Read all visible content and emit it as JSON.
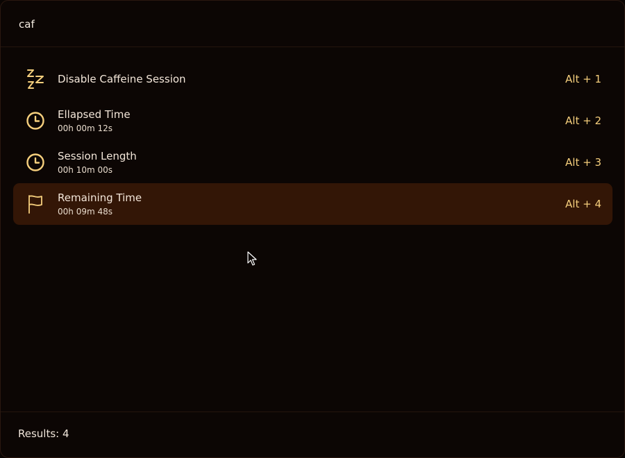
{
  "search": {
    "value": "caf",
    "placeholder": ""
  },
  "results": [
    {
      "icon": "sleep-zzz-icon",
      "title": "Disable Caffeine Session",
      "subtitle": "",
      "shortcut": "Alt + 1",
      "selected": false
    },
    {
      "icon": "clock-icon",
      "title": "Ellapsed Time",
      "subtitle": "00h 00m 12s",
      "shortcut": "Alt + 2",
      "selected": false
    },
    {
      "icon": "clock-icon",
      "title": "Session Length",
      "subtitle": "00h 10m 00s",
      "shortcut": "Alt + 3",
      "selected": false
    },
    {
      "icon": "flag-icon",
      "title": "Remaining Time",
      "subtitle": "00h 09m 48s",
      "shortcut": "Alt + 4",
      "selected": true
    }
  ],
  "footer": {
    "results_label": "Results: 4"
  },
  "colors": {
    "background": "#0c0604",
    "selected_row": "#331606",
    "accent": "#f6cf7d"
  }
}
